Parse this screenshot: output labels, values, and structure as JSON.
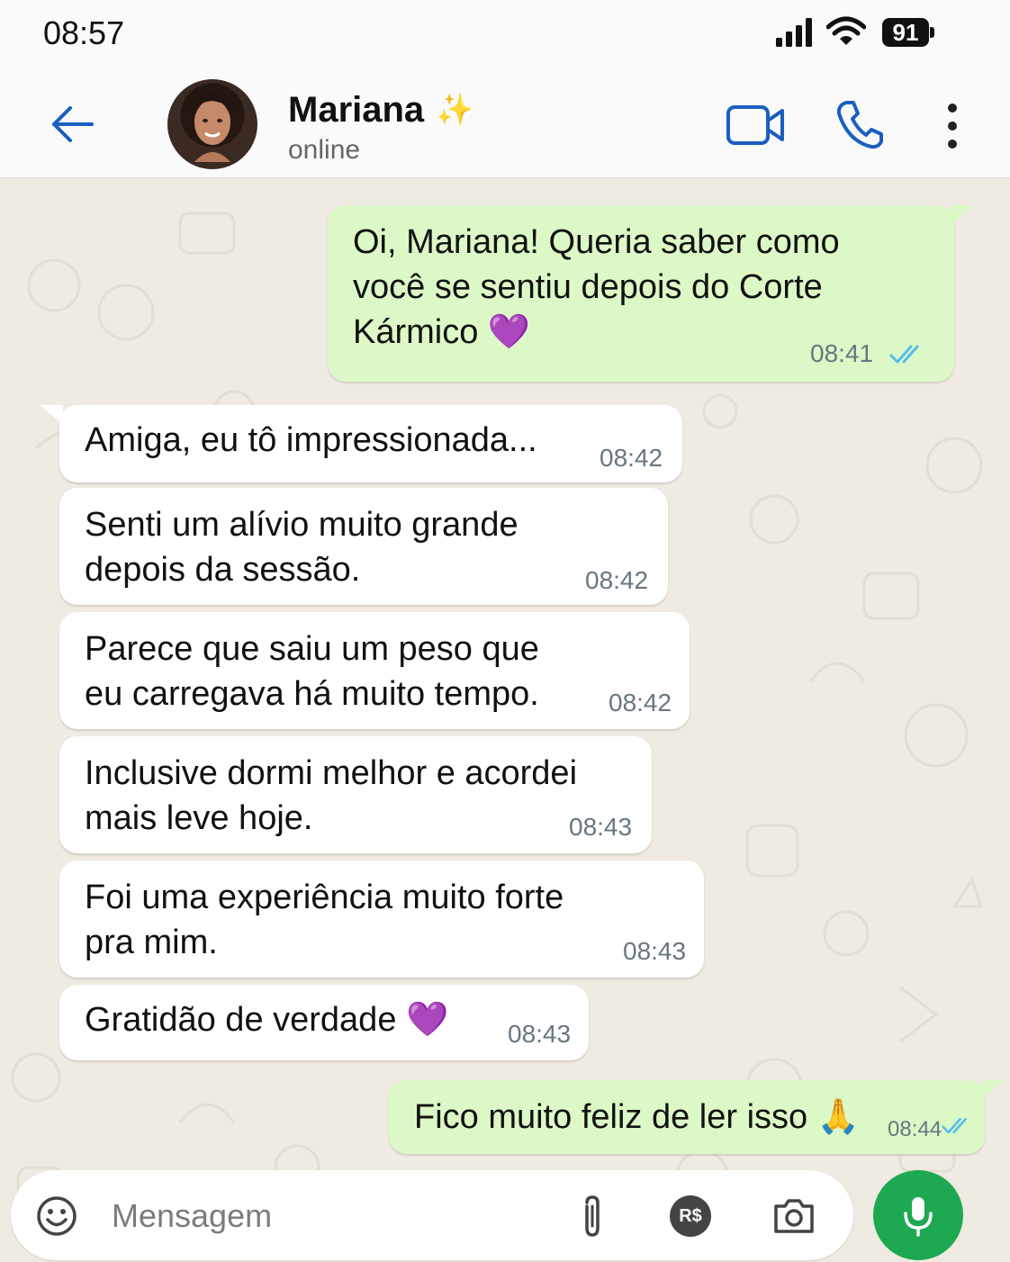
{
  "status_bar": {
    "time": "08:57",
    "battery": "91"
  },
  "header": {
    "contact_name": "Mariana",
    "contact_name_emoji": "✨",
    "contact_status": "online",
    "icons": [
      "back-arrow-icon",
      "video-call-icon",
      "phone-icon",
      "more-options-icon"
    ]
  },
  "messages": [
    {
      "direction": "outgoing",
      "lines": [
        "Oi, Mariana! Queria saber como",
        "você se sentiu depois do Corte",
        "Kármico 💜"
      ],
      "time": "08:41",
      "status": "read"
    },
    {
      "direction": "incoming",
      "lines": [
        "Amiga, eu tô impressionada..."
      ],
      "time": "08:42"
    },
    {
      "direction": "incoming",
      "lines": [
        "Senti um alívio muito grande",
        "depois da sessão."
      ],
      "time": "08:42"
    },
    {
      "direction": "incoming",
      "lines": [
        "Parece que saiu um peso que",
        "eu carregava há muito tempo."
      ],
      "time": "08:42"
    },
    {
      "direction": "incoming",
      "lines": [
        "Inclusive dormi melhor e acordei",
        "mais leve hoje."
      ],
      "time": "08:43"
    },
    {
      "direction": "incoming",
      "lines": [
        "Foi uma experiência muito forte",
        "pra mim."
      ],
      "time": "08:43"
    },
    {
      "direction": "incoming",
      "lines": [
        "Gratidão de verdade 💜"
      ],
      "time": "08:43"
    },
    {
      "direction": "outgoing",
      "lines": [
        "Fico muito feliz de ler isso 🙏"
      ],
      "time": "08:44",
      "status": "read"
    }
  ],
  "composer": {
    "placeholder": "Mensagem",
    "payment_label": "R$",
    "icons": [
      "emoji-icon",
      "paperclip-icon",
      "payment-icon",
      "camera-icon",
      "microphone-icon"
    ]
  },
  "colors": {
    "outgoing_bubble": "#dcf8c6",
    "incoming_bubble": "#ffffff",
    "accent_blue": "#1a5fc0",
    "mic_green": "#1da851",
    "read_ticks": "#53bdeb"
  }
}
